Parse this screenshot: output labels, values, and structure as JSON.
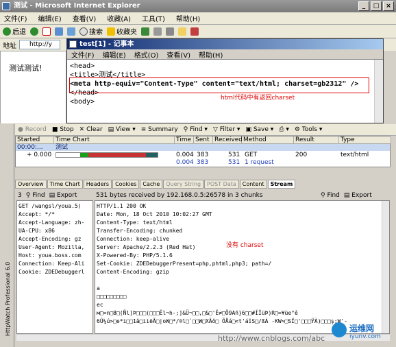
{
  "ie": {
    "title": "测试 - Microsoft Internet Explorer",
    "menu": [
      "文件(F)",
      "编辑(E)",
      "查看(V)",
      "收藏(A)",
      "工具(T)",
      "帮助(H)"
    ],
    "toolbar": {
      "back": "后退",
      "search": "搜索",
      "favorites": "收藏夹"
    },
    "address_label": "地址",
    "address_value": "http://y",
    "page_text": "测试测试!"
  },
  "notepad": {
    "title": "test[1] - 记事本",
    "menu": [
      "文件(F)",
      "编辑(E)",
      "格式(O)",
      "查看(V)",
      "帮助(H)"
    ],
    "lines": [
      "<head>",
      "<title>测试</title>",
      "<meta http-equiv=\"Content-Type\" content=\"text/html; charset=gb2312\" />",
      "</head>",
      "<body>"
    ],
    "annotation": "html代码中有返回charset"
  },
  "httpwatch": {
    "side_label": "HttpWatch Professional 6.0",
    "toolbar": [
      "Record",
      "Stop",
      "Clear",
      "View",
      "Summary",
      "Find",
      "Filter",
      "Save",
      "Tools"
    ],
    "columns": [
      "Started",
      "Time Chart",
      "Time",
      "Sent",
      "Received",
      "Method",
      "Result",
      "Type"
    ],
    "group_row": {
      "started": "00:00:...",
      "label": "测试"
    },
    "row": {
      "started": "+ 0.000",
      "time": "0.004",
      "sent": "383",
      "received": "531",
      "method": "GET",
      "result": "200",
      "type": "text/html"
    },
    "summary": {
      "time": "0.004",
      "sent": "383",
      "received": "531",
      "requests": "1 request"
    },
    "tabs": [
      "Overview",
      "Time Chart",
      "Headers",
      "Cookies",
      "Cache",
      "Query String",
      "POST Data",
      "Content",
      "Stream"
    ],
    "req_count": "3",
    "find": "Find",
    "export": "Export",
    "stream_info": "531 bytes received by 192.168.0.5:26578 in 3 chunks",
    "request_lines": [
      "GET /wangsl/youa.5(",
      "Accept: */*",
      "Accept-Language: zh-",
      "UA-CPU: x86",
      "Accept-Encoding: gz",
      "User-Agent: Mozilla,",
      "Host: youa.boss.com",
      "Connection: Keep-Ali",
      "Cookie: ZDEDebuggerl"
    ],
    "response_lines": [
      "HTTP/1.1 200 OK",
      "Date: Mon, 18 Oct 2010 10:02:27 GMT",
      "Content-Type: text/html",
      "Transfer-Encoding: chunked",
      "Connection: keep-alive",
      "Server: Apache/2.2.3 (Red Hat)",
      "X-Powered-By: PHP/5.1.6",
      "Set-Cookie: ZDEDebuggerPresent=php,phtml,php3; path=/",
      "Content-Encoding: gzip",
      "",
      "a",
      "□□□□□□□□□",
      "ec",
      "м□=n□8□(Ñl]Þ□□□(□□□Êl¬h-;]&Ü¬□□,□&□'Ê≠□Õ9Añ}6□□#ÍÏüÞ)R□=¥üe°ê",
      "6Û¼ú>□e*i□□1â□iiëÃ□|oW□*/®l□ʹ□□W□XÂô□ ÕÅá□<t'áîS□/ßÀ -KW≈□SÏ□'□□□ŸÀ)□□□ş;W'-"
    ],
    "no_charset_note": "没有 charset"
  },
  "watermark": {
    "url": "http://www.cnblogs.com/abc",
    "brand": "运维网",
    "site": "iyunv.com"
  },
  "colors": {
    "annotation": "#e00000",
    "notepad_title": "#0a246a"
  }
}
